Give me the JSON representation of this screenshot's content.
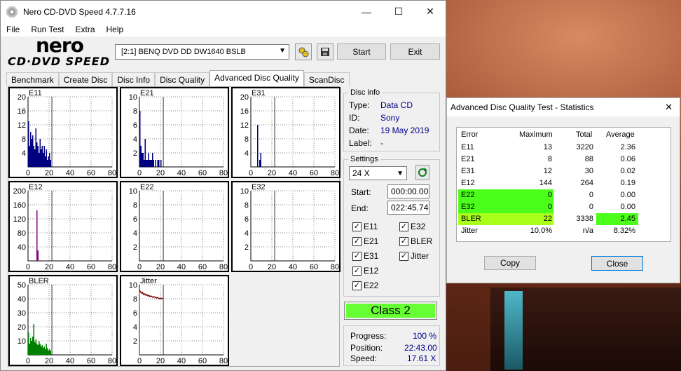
{
  "main_window": {
    "title": "Nero CD-DVD Speed 4.7.7.16",
    "controls": {
      "minimize": "—",
      "maximize": "☐",
      "close": "✕"
    },
    "menu": [
      "File",
      "Run Test",
      "Extra",
      "Help"
    ],
    "logo": {
      "line1": "nero",
      "line2": "CD·DVD SPEED"
    },
    "drive": "[2:1]   BENQ DVD DD DW1640 BSLB",
    "start_label": "Start",
    "exit_label": "Exit",
    "tabs": [
      "Benchmark",
      "Create Disc",
      "Disc Info",
      "Disc Quality",
      "Advanced Disc Quality",
      "ScanDisc"
    ],
    "active_tab": 4
  },
  "graphs": [
    {
      "name": "E11",
      "yticks": [
        "20",
        "16",
        "12",
        "8",
        "4"
      ],
      "ymax": 20,
      "xticks": [
        "0",
        "20",
        "40",
        "60",
        "80"
      ],
      "kind": "bars",
      "color": "#000080"
    },
    {
      "name": "E21",
      "yticks": [
        "10",
        "8",
        "6",
        "4",
        "2"
      ],
      "ymax": 10,
      "xticks": [
        "0",
        "20",
        "40",
        "60",
        "80"
      ],
      "kind": "bars",
      "color": "#000080"
    },
    {
      "name": "E31",
      "yticks": [
        "20",
        "16",
        "12",
        "8",
        "4"
      ],
      "ymax": 20,
      "xticks": [
        "0",
        "20",
        "40",
        "60",
        "80"
      ],
      "kind": "bars",
      "color": "#000080"
    },
    {
      "name": "E12",
      "yticks": [
        "200",
        "160",
        "120",
        "80",
        "40"
      ],
      "ymax": 200,
      "xticks": [
        "0",
        "20",
        "40",
        "60",
        "80"
      ],
      "kind": "bars",
      "color": "#800080"
    },
    {
      "name": "E22",
      "yticks": [
        "10",
        "8",
        "6",
        "4",
        "2"
      ],
      "ymax": 10,
      "xticks": [
        "0",
        "20",
        "40",
        "60",
        "80"
      ],
      "kind": "none",
      "color": "#000080"
    },
    {
      "name": "E32",
      "yticks": [
        "10",
        "8",
        "6",
        "4",
        "2"
      ],
      "ymax": 10,
      "xticks": [
        "0",
        "20",
        "40",
        "60",
        "80"
      ],
      "kind": "none",
      "color": "#000080"
    },
    {
      "name": "BLER",
      "yticks": [
        "50",
        "40",
        "30",
        "20",
        "10"
      ],
      "ymax": 50,
      "xticks": [
        "0",
        "20",
        "40",
        "60",
        "80"
      ],
      "kind": "bars",
      "color": "#008000"
    },
    {
      "name": "Jitter",
      "yticks": [
        "10",
        "8",
        "6",
        "4",
        "2"
      ],
      "ymax": 10,
      "xticks": [
        "0",
        "20",
        "40",
        "60",
        "80"
      ],
      "kind": "line",
      "color": "#800000"
    }
  ],
  "chart_data": [
    {
      "type": "bar",
      "title": "E11",
      "x_range": [
        0,
        80
      ],
      "ylim": [
        0,
        20
      ],
      "x": [
        1,
        2,
        3,
        4,
        5,
        6,
        7,
        8,
        9,
        10,
        11,
        12,
        13,
        14,
        15,
        16,
        17,
        18,
        19,
        20,
        21,
        22
      ],
      "values": [
        13,
        6,
        10,
        8,
        9,
        6,
        5,
        11,
        7,
        6,
        4,
        8,
        5,
        6,
        4,
        6,
        3,
        5,
        2,
        3,
        4,
        2
      ]
    },
    {
      "type": "bar",
      "title": "E21",
      "x_range": [
        0,
        80
      ],
      "ylim": [
        0,
        10
      ],
      "x": [
        1,
        2,
        3,
        4,
        5,
        6,
        7,
        8,
        9,
        10,
        11,
        12,
        13,
        14,
        15,
        16,
        17,
        18,
        19,
        20,
        21,
        22
      ],
      "values": [
        8,
        3,
        2,
        2,
        1,
        4,
        1,
        1,
        2,
        1,
        1,
        1,
        2,
        1,
        0,
        1,
        0,
        1,
        1,
        0,
        1,
        0
      ]
    },
    {
      "type": "bar",
      "title": "E31",
      "x_range": [
        0,
        80
      ],
      "ylim": [
        0,
        20
      ],
      "x": [
        7,
        9,
        10
      ],
      "values": [
        12,
        2,
        4
      ]
    },
    {
      "type": "bar",
      "title": "E12",
      "x_range": [
        0,
        80
      ],
      "ylim": [
        0,
        200
      ],
      "x": [
        9,
        10
      ],
      "values": [
        144,
        30
      ]
    },
    {
      "type": "bar",
      "title": "E22",
      "x_range": [
        0,
        80
      ],
      "ylim": [
        0,
        10
      ],
      "x": [],
      "values": []
    },
    {
      "type": "bar",
      "title": "E32",
      "x_range": [
        0,
        80
      ],
      "ylim": [
        0,
        10
      ],
      "x": [],
      "values": []
    },
    {
      "type": "bar",
      "title": "BLER",
      "x_range": [
        0,
        80
      ],
      "ylim": [
        0,
        50
      ],
      "x": [
        1,
        2,
        3,
        4,
        5,
        6,
        7,
        8,
        9,
        10,
        11,
        12,
        13,
        14,
        15,
        16,
        17,
        18,
        19,
        20,
        21,
        22
      ],
      "values": [
        16,
        8,
        12,
        10,
        13,
        22,
        9,
        11,
        8,
        7,
        10,
        8,
        6,
        7,
        5,
        6,
        4,
        8,
        5,
        3,
        4,
        3
      ]
    },
    {
      "type": "line",
      "title": "Jitter",
      "x_range": [
        0,
        80
      ],
      "ylim": [
        0,
        10
      ],
      "x": [
        0,
        1,
        2,
        3,
        4,
        5,
        6,
        7,
        8,
        9,
        10,
        11,
        12,
        13,
        14,
        15,
        16,
        17,
        18,
        19,
        20,
        21,
        22
      ],
      "values": [
        9.2,
        9.0,
        8.8,
        8.9,
        8.6,
        8.7,
        8.5,
        8.6,
        8.4,
        8.5,
        8.3,
        8.4,
        8.3,
        8.2,
        8.3,
        8.2,
        8.1,
        8.2,
        8.1,
        8.0,
        8.1,
        8.0,
        8.1
      ]
    }
  ],
  "disc_info": {
    "title": "Disc info",
    "rows": [
      {
        "key": "Type:",
        "value": "Data CD"
      },
      {
        "key": "ID:",
        "value": "Sony"
      },
      {
        "key": "Date:",
        "value": "19 May 2019"
      },
      {
        "key": "Label:",
        "value": "-"
      }
    ]
  },
  "settings": {
    "title": "Settings",
    "speed": "24 X",
    "start_label": "Start:",
    "start_value": "000:00.00",
    "end_label": "End:",
    "end_value": "022:45.74",
    "checks_left": [
      "E11",
      "E21",
      "E31",
      "E12",
      "E22"
    ],
    "checks_right": [
      "E32",
      "BLER",
      "Jitter"
    ]
  },
  "class_label": "Class 2",
  "progress": {
    "progress_label": "Progress:",
    "progress_value": "100 %",
    "position_label": "Position:",
    "position_value": "22:43.00",
    "speed_label": "Speed:",
    "speed_value": "17.61 X"
  },
  "stats_window": {
    "title": "Advanced Disc Quality Test - Statistics",
    "close_glyph": "✕",
    "headers": [
      "Error",
      "Maximum",
      "Total",
      "Average"
    ],
    "rows": [
      {
        "error": "E11",
        "max": "13",
        "total": "3220",
        "avg": "2.36"
      },
      {
        "error": "E21",
        "max": "8",
        "total": "88",
        "avg": "0.06"
      },
      {
        "error": "E31",
        "max": "12",
        "total": "30",
        "avg": "0.02"
      },
      {
        "error": "E12",
        "max": "144",
        "total": "264",
        "avg": "0.19"
      },
      {
        "error": "E22",
        "max": "0",
        "total": "0",
        "avg": "0.00"
      },
      {
        "error": "E32",
        "max": "0",
        "total": "0",
        "avg": "0.00"
      },
      {
        "error": "BLER",
        "max": "22",
        "total": "3338",
        "avg": "2.45"
      },
      {
        "error": "Jitter",
        "max": "10.0%",
        "total": "n/a",
        "avg": "8.32%"
      }
    ],
    "copy_label": "Copy",
    "close_label": "Close",
    "highlight_color": "#4cff1a",
    "bler_color": "#a8ff1a"
  }
}
